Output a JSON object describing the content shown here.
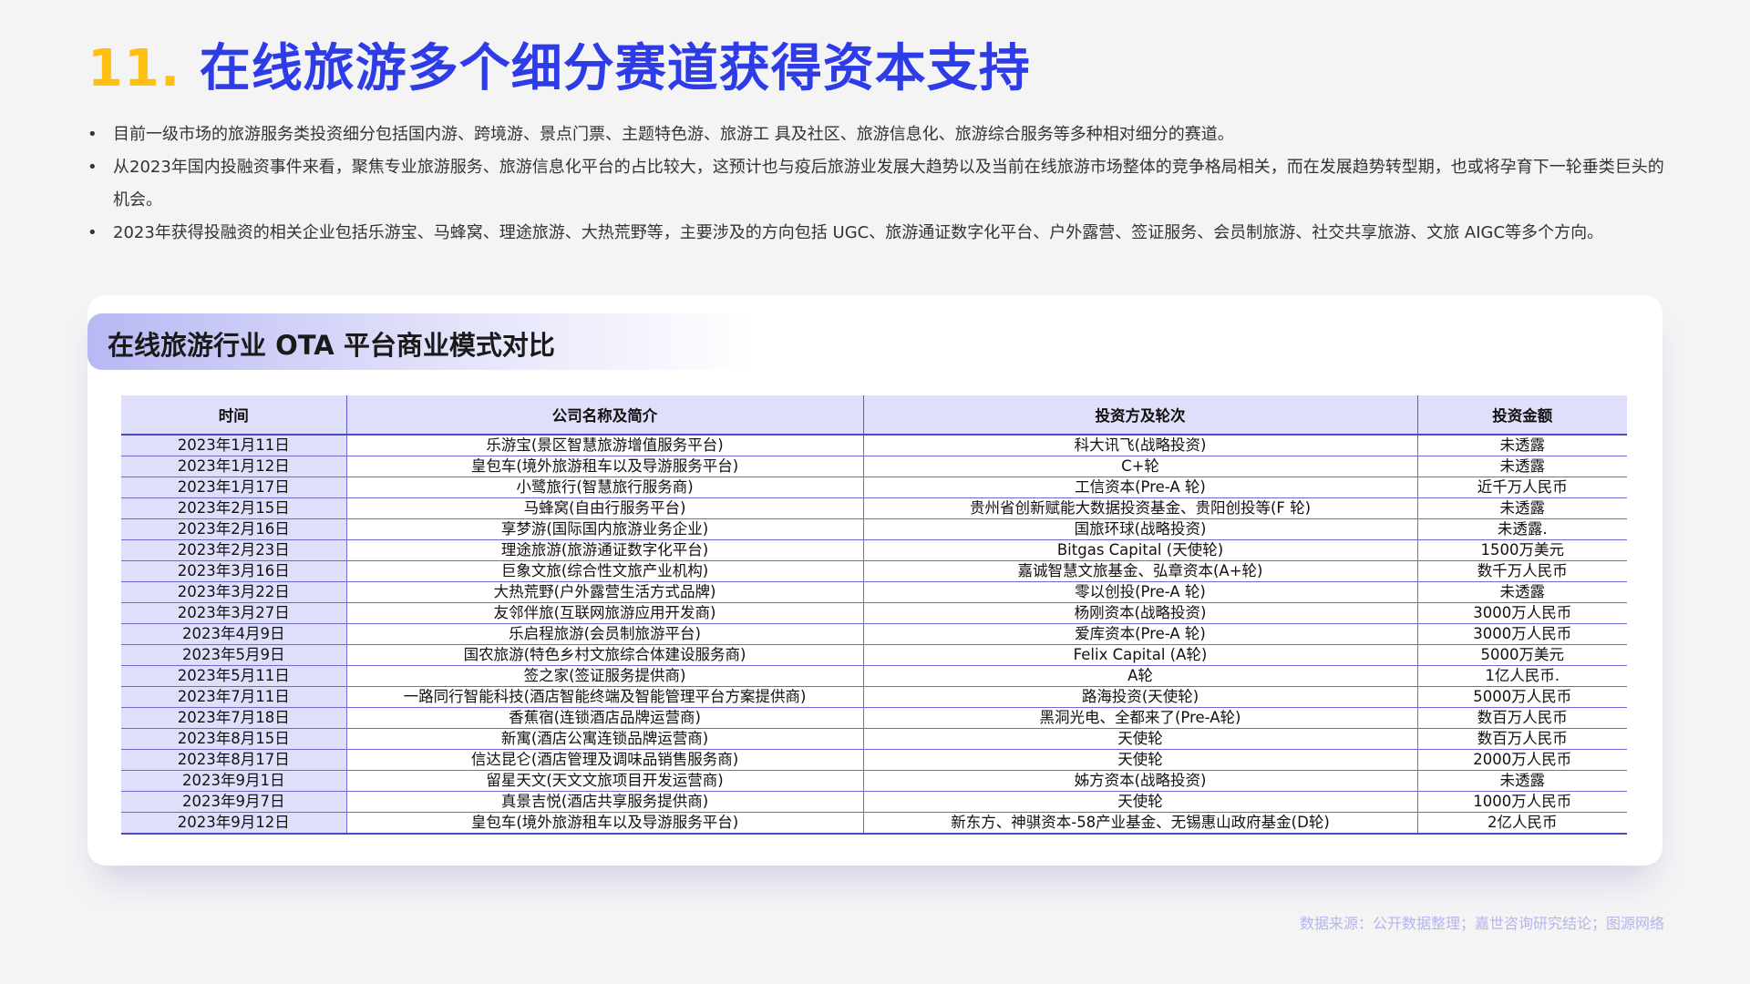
{
  "page": {
    "title_number": "11.",
    "title_text": "在线旅游多个细分赛道获得资本支持",
    "bullets": [
      "目前一级市场的旅游服务类投资细分包括国内游、跨境游、景点门票、主题特色游、旅游工 具及社区、旅游信息化、旅游综合服务等多种相对细分的赛道。",
      "从2023年国内投融资事件来看，聚焦专业旅游服务、旅游信息化平台的占比较大，这预计也与疫后旅游业发展大趋势以及当前在线旅游市场整体的竞争格局相关，而在发展趋势转型期，也或将孕育下一轮垂类巨头的机会。",
      "2023年获得投融资的相关企业包括乐游宝、马蜂窝、理途旅游、大热荒野等，主要涉及的方向包括 UGC、旅游通证数字化平台、户外露营、签证服务、会员制旅游、社交共享旅游、文旅 AIGC等多个方向。"
    ],
    "source": "数据来源：公开数据整理；嘉世咨询研究结论；图源网络"
  },
  "card": {
    "title": "在线旅游行业 OTA 平台商业模式对比",
    "headers": [
      "时间",
      "公司名称及简介",
      "投资方及轮次",
      "投资金额"
    ],
    "rows": [
      [
        "2023年1月11日",
        "乐游宝(景区智慧旅游增值服务平台)",
        "科大讯飞(战略投资)",
        "未透露"
      ],
      [
        "2023年1月12日",
        "皇包车(境外旅游租车以及导游服务平台)",
        "C+轮",
        "未透露"
      ],
      [
        "2023年1月17日",
        "小鹭旅行(智慧旅行服务商)",
        "工信资本(Pre-A 轮)",
        "近千万人民币"
      ],
      [
        "2023年2月15日",
        "马蜂窝(自由行服务平台)",
        "贵州省创新赋能大数据投资基金、贵阳创投等(F 轮)",
        "未透露"
      ],
      [
        "2023年2月16日",
        "享梦游(国际国内旅游业务企业)",
        "国旅环球(战略投资)",
        "未透露."
      ],
      [
        "2023年2月23日",
        "理途旅游(旅游通证数字化平台)",
        "Bitgas Capital (天使轮)",
        "1500万美元"
      ],
      [
        "2023年3月16日",
        "巨象文旅(综合性文旅产业机构)",
        "嘉诚智慧文旅基金、弘章资本(A+轮)",
        "数千万人民币"
      ],
      [
        "2023年3月22日",
        "大热荒野(户外露营生活方式品牌)",
        "零以创投(Pre-A 轮)",
        "未透露"
      ],
      [
        "2023年3月27日",
        "友邻伴旅(互联网旅游应用开发商)",
        "杨刚资本(战略投资)",
        "3000万人民币"
      ],
      [
        "2023年4月9日",
        "乐启程旅游(会员制旅游平台)",
        "爱库资本(Pre-A 轮)",
        "3000万人民币"
      ],
      [
        "2023年5月9日",
        "国农旅游(特色乡村文旅综合体建设服务商)",
        "Felix Capital (A轮)",
        "5000万美元"
      ],
      [
        "2023年5月11日",
        "签之家(签证服务提供商)",
        "A轮",
        "1亿人民币."
      ],
      [
        "2023年7月11日",
        "一路同行智能科技(酒店智能终端及智能管理平台方案提供商)",
        "路海投资(天使轮)",
        "5000万人民币"
      ],
      [
        "2023年7月18日",
        "香蕉宿(连锁酒店品牌运营商)",
        "黑洞光电、全都来了(Pre-A轮)",
        "数百万人民币"
      ],
      [
        "2023年8月15日",
        "新寓(酒店公寓连锁品牌运营商)",
        "天使轮",
        "数百万人民币"
      ],
      [
        "2023年8月17日",
        "信达昆仑(酒店管理及调味品销售服务商)",
        "天使轮",
        "2000万人民币"
      ],
      [
        "2023年9月1日",
        "留星天文(天文文旅项目开发运营商)",
        "姊方资本(战略投资)",
        "未透露"
      ],
      [
        "2023年9月7日",
        "真景吉悦(酒店共享服务提供商)",
        "天使轮",
        "1000万人民币"
      ],
      [
        "2023年9月12日",
        "皇包车(境外旅游租车以及导游服务平台)",
        "新东方、神骐资本-58产业基金、无锡惠山政府基金(D轮)",
        "2亿人民币"
      ]
    ]
  },
  "colors": {
    "title_number": "#ffbf10",
    "title_text": "#2d3ce6",
    "table_header_bg": "#dfdffb",
    "table_line": "#4a4ac8",
    "source_text": "#b5b5ee"
  }
}
